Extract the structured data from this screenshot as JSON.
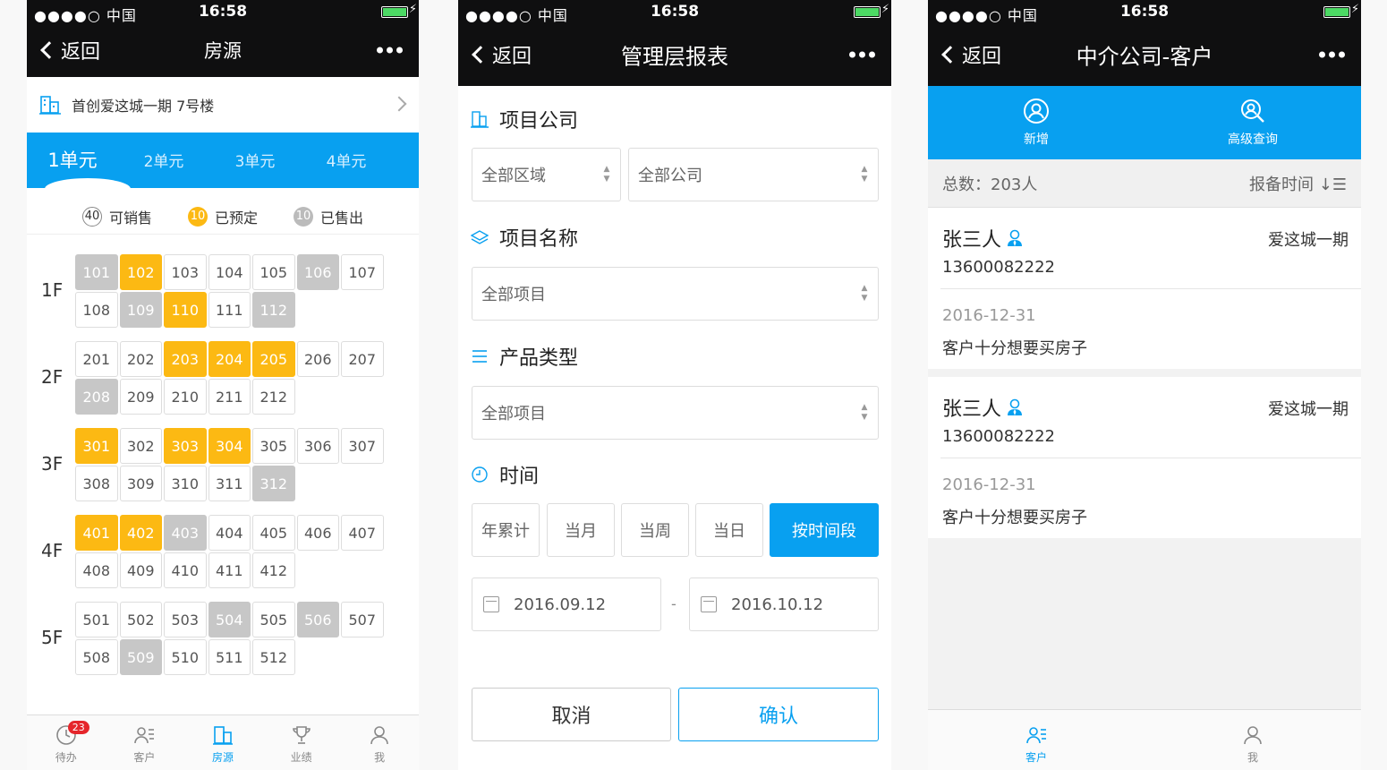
{
  "status": {
    "carrier": "●●●●○ 中国",
    "time": "16:58",
    "bolt": "⚡"
  },
  "screen1": {
    "back": "返回",
    "title": "房源",
    "building": "首创爱这城一期 7号楼",
    "units": [
      "1单元",
      "2单元",
      "3单元",
      "4单元"
    ],
    "legend": [
      {
        "count": "40",
        "label": "可销售"
      },
      {
        "count": "10",
        "label": "已预定"
      },
      {
        "count": "10",
        "label": "已售出"
      }
    ],
    "floors": [
      {
        "label": "1F",
        "rooms": [
          [
            "101",
            "s"
          ],
          [
            "102",
            "r"
          ],
          [
            "103",
            ""
          ],
          [
            "104",
            ""
          ],
          [
            "105",
            ""
          ],
          [
            "106",
            "s"
          ],
          [
            "107",
            ""
          ],
          [
            "108",
            ""
          ],
          [
            "109",
            "s"
          ],
          [
            "110",
            "r"
          ],
          [
            "111",
            ""
          ],
          [
            "112",
            "s"
          ]
        ]
      },
      {
        "label": "2F",
        "rooms": [
          [
            "201",
            ""
          ],
          [
            "202",
            ""
          ],
          [
            "203",
            "r"
          ],
          [
            "204",
            "r"
          ],
          [
            "205",
            "r"
          ],
          [
            "206",
            ""
          ],
          [
            "207",
            ""
          ],
          [
            "208",
            "s"
          ],
          [
            "209",
            ""
          ],
          [
            "210",
            ""
          ],
          [
            "211",
            ""
          ],
          [
            "212",
            ""
          ]
        ]
      },
      {
        "label": "3F",
        "rooms": [
          [
            "301",
            "r"
          ],
          [
            "302",
            ""
          ],
          [
            "303",
            "r"
          ],
          [
            "304",
            "r"
          ],
          [
            "305",
            ""
          ],
          [
            "306",
            ""
          ],
          [
            "307",
            ""
          ],
          [
            "308",
            ""
          ],
          [
            "309",
            ""
          ],
          [
            "310",
            ""
          ],
          [
            "311",
            ""
          ],
          [
            "312",
            "s"
          ]
        ]
      },
      {
        "label": "4F",
        "rooms": [
          [
            "401",
            "r"
          ],
          [
            "402",
            "r"
          ],
          [
            "403",
            "s"
          ],
          [
            "404",
            ""
          ],
          [
            "405",
            ""
          ],
          [
            "406",
            ""
          ],
          [
            "407",
            ""
          ],
          [
            "408",
            ""
          ],
          [
            "409",
            ""
          ],
          [
            "410",
            ""
          ],
          [
            "411",
            ""
          ],
          [
            "412",
            ""
          ]
        ]
      },
      {
        "label": "5F",
        "rooms": [
          [
            "501",
            ""
          ],
          [
            "502",
            ""
          ],
          [
            "503",
            ""
          ],
          [
            "504",
            "s"
          ],
          [
            "505",
            ""
          ],
          [
            "506",
            "s"
          ],
          [
            "507",
            ""
          ],
          [
            "508",
            ""
          ],
          [
            "509",
            "s"
          ],
          [
            "510",
            ""
          ],
          [
            "511",
            ""
          ],
          [
            "512",
            ""
          ]
        ]
      }
    ],
    "tabs": [
      "待办",
      "客户",
      "房源",
      "业绩",
      "我"
    ],
    "badge": "23"
  },
  "screen2": {
    "back": "返回",
    "title": "管理层报表",
    "sec_company": "项目公司",
    "region": "全部区域",
    "company": "全部公司",
    "sec_project": "项目名称",
    "project": "全部项目",
    "sec_type": "产品类型",
    "type": "全部项目",
    "sec_time": "时间",
    "time_buttons": [
      "年累计",
      "当月",
      "当周",
      "当日",
      "按时间段"
    ],
    "date_from": "2016.09.12",
    "date_sep": "-",
    "date_to": "2016.10.12",
    "cancel": "取消",
    "confirm": "确认"
  },
  "screen3": {
    "back": "返回",
    "title": "中介公司-客户",
    "add": "新增",
    "advanced": "高级查询",
    "total": "总数：203人",
    "sort": "报备时间 ↓☰",
    "customers": [
      {
        "name": "张三人",
        "project": "爱这城一期",
        "phone": "13600082222",
        "date": "2016-12-31",
        "note": "客户十分想要买房子"
      },
      {
        "name": "张三人",
        "project": "爱这城一期",
        "phone": "13600082222",
        "date": "2016-12-31",
        "note": "客户十分想要买房子"
      }
    ],
    "tabs": [
      "客户",
      "我"
    ]
  },
  "colors": {
    "accent": "#08a0f0",
    "reserved": "#fcb913",
    "sold": "#c7c7c7",
    "badge": "#e5262b"
  }
}
